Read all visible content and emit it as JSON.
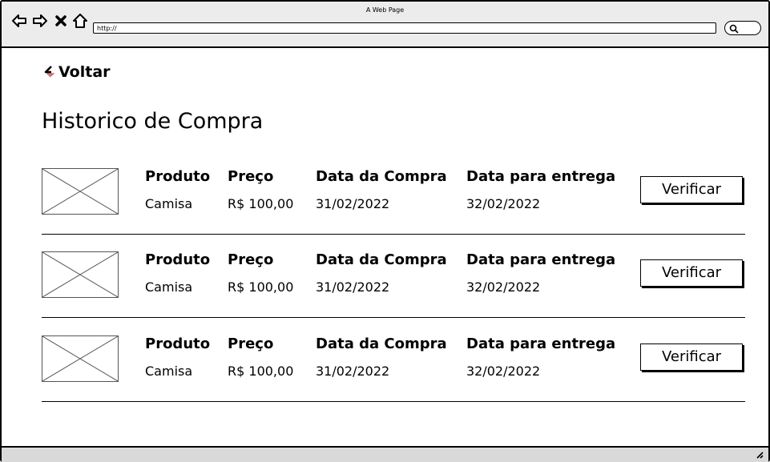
{
  "window": {
    "title": "A Web Page",
    "url": "http://"
  },
  "icons": {
    "back": "arrow-left-icon",
    "forward": "arrow-right-icon",
    "stop": "close-icon",
    "home": "home-icon",
    "search": "search-icon",
    "voltar": "back-arrow-icon"
  },
  "page": {
    "back_label": "Voltar",
    "title": "Historico de Compra"
  },
  "purchases": [
    {
      "produto_label": "Produto",
      "produto": "Camisa",
      "preco_label": "Preço",
      "preco": "R$ 100,00",
      "compra_label": "Data da Compra",
      "compra": "31/02/2022",
      "entrega_label": "Data para entrega",
      "entrega": "32/02/2022",
      "button": "Verificar"
    },
    {
      "produto_label": "Produto",
      "produto": "Camisa",
      "preco_label": "Preço",
      "preco": "R$ 100,00",
      "compra_label": "Data da Compra",
      "compra": "31/02/2022",
      "entrega_label": "Data para entrega",
      "entrega": "32/02/2022",
      "button": "Verificar"
    },
    {
      "produto_label": "Produto",
      "produto": "Camisa",
      "preco_label": "Preço",
      "preco": "R$ 100,00",
      "compra_label": "Data da Compra",
      "compra": "31/02/2022",
      "entrega_label": "Data para entrega",
      "entrega": "32/02/2022",
      "button": "Verificar"
    }
  ]
}
